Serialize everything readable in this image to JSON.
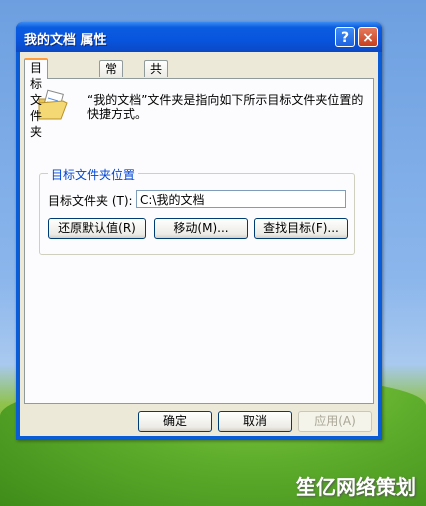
{
  "window": {
    "title": "我的文档 属性",
    "help_label": "?",
    "close_label": "×"
  },
  "tabs": [
    {
      "label": "目标文件夹",
      "active": true
    },
    {
      "label": "常规",
      "active": false
    },
    {
      "label": "共享",
      "active": false
    }
  ],
  "panel": {
    "icon": "documents-folder-icon",
    "description": "“我的文档”文件夹是指向如下所示目标文件夹位置的快捷方式。",
    "group_title": "目标文件夹位置",
    "target_label": "目标文件夹 (T):",
    "target_value": "C:\\我的文档",
    "restore_button": "还原默认值(R)",
    "move_button": "移动(M)...",
    "find_button": "查找目标(F)..."
  },
  "footer": {
    "ok": "确定",
    "cancel": "取消",
    "apply": "应用(A)"
  },
  "watermark": "笙亿网络策划",
  "colors": {
    "titlebar": "#0855dd",
    "client": "#ece9d8",
    "tab_highlight": "#ff9c3c",
    "group_title": "#0046d5"
  }
}
